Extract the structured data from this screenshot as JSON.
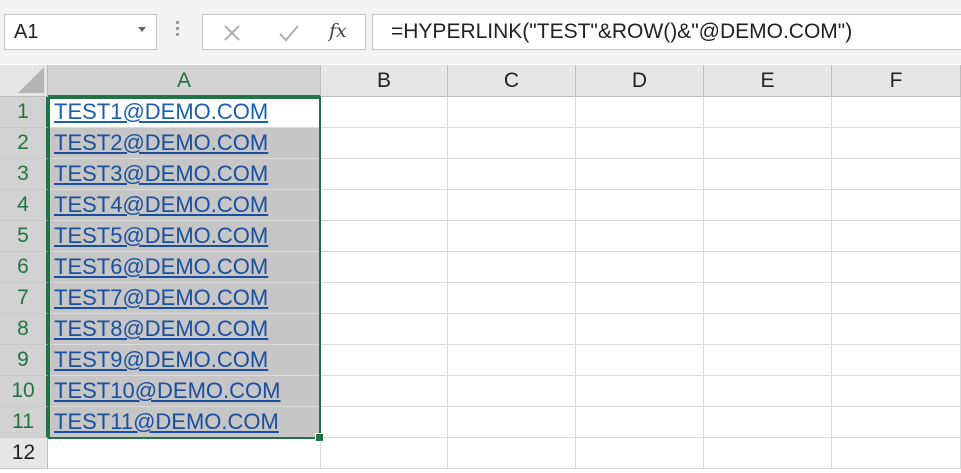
{
  "formula_bar": {
    "name_box": "A1",
    "cancel_icon": "close-icon",
    "enter_icon": "check-icon",
    "fx_label": "fx",
    "formula": "=HYPERLINK(\"TEST\"&ROW()&\"@DEMO.COM\")"
  },
  "columns": [
    "A",
    "B",
    "C",
    "D",
    "E",
    "F"
  ],
  "rows": [
    "1",
    "2",
    "3",
    "4",
    "5",
    "6",
    "7",
    "8",
    "9",
    "10",
    "11",
    "12"
  ],
  "cells_a": [
    "TEST1@DEMO.COM",
    "TEST2@DEMO.COM",
    "TEST3@DEMO.COM",
    "TEST4@DEMO.COM",
    "TEST5@DEMO.COM",
    "TEST6@DEMO.COM",
    "TEST7@DEMO.COM",
    "TEST8@DEMO.COM",
    "TEST9@DEMO.COM",
    "TEST10@DEMO.COM",
    "TEST11@DEMO.COM",
    ""
  ],
  "selection": {
    "range": "A1:A11",
    "active_cell": "A1"
  },
  "colors": {
    "selection_border": "#217346",
    "hyperlink": "#1a5fb4",
    "selection_fill": "#c6c6c6"
  }
}
